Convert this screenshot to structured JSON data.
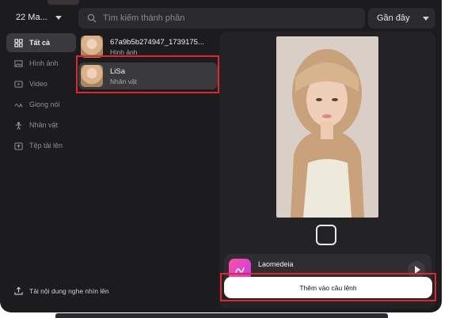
{
  "header": {
    "project_name": "22 Ma...",
    "search_placeholder": "Tìm kiếm thành phần",
    "sort_label": "Gần đây"
  },
  "sidebar": {
    "items": [
      {
        "label": "Tất cả",
        "icon": "grid-icon",
        "active": true
      },
      {
        "label": "Hình ảnh",
        "icon": "image-icon",
        "active": false
      },
      {
        "label": "Video",
        "icon": "video-icon",
        "active": false
      },
      {
        "label": "Giọng nói",
        "icon": "voice-icon",
        "active": false
      },
      {
        "label": "Nhân vật",
        "icon": "person-icon",
        "active": false
      },
      {
        "label": "Tệp tải lên",
        "icon": "upload-folder-icon",
        "active": false
      }
    ],
    "upload_label": "Tải nội dung nghe nhìn lên"
  },
  "list": {
    "items": [
      {
        "title": "67a9b5b274947_1739175...",
        "type": "Hình ảnh",
        "selected": false
      },
      {
        "title": "LiSa",
        "type": "Nhân vật",
        "selected": true
      }
    ]
  },
  "preview": {
    "app_name": "Laomedeia",
    "add_button_label": "Thêm vào câu lệnh"
  },
  "colors": {
    "background": "#1c1c1e",
    "highlight": "#e0272b",
    "accent": "#ff4fa0"
  }
}
